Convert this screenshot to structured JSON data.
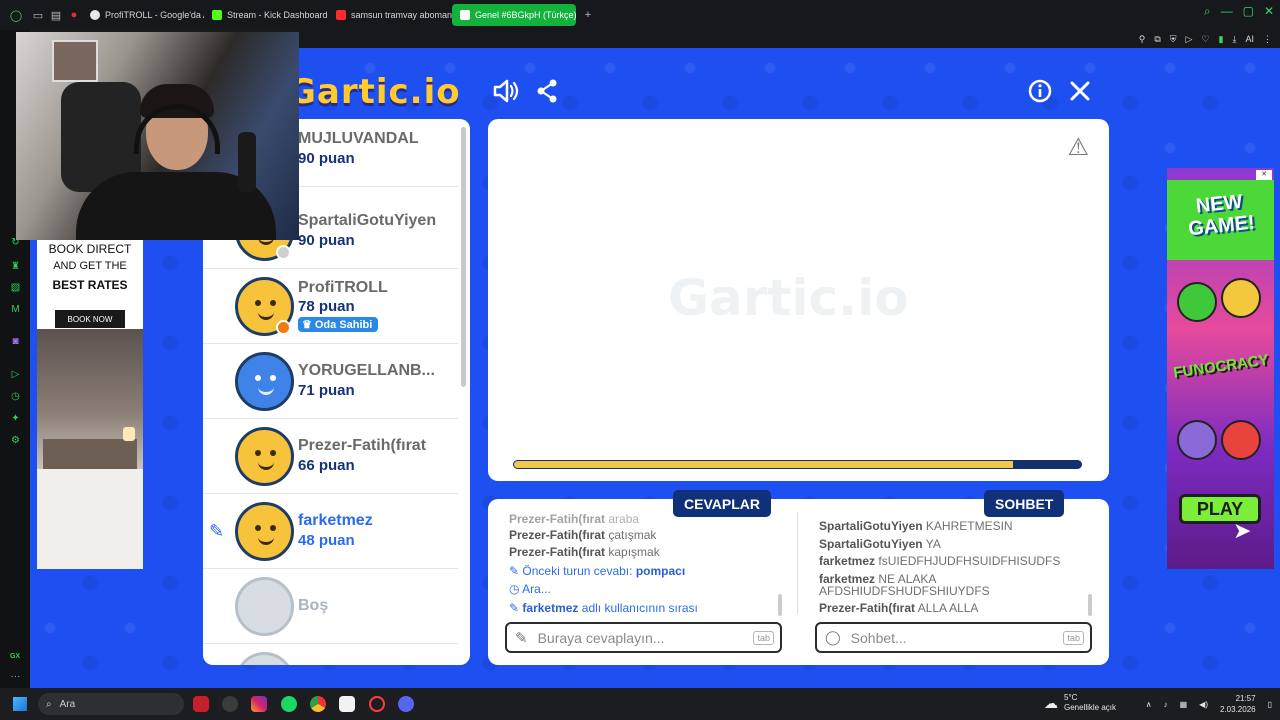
{
  "browser": {
    "tabs": [
      {
        "label": "ProfiTROLL - Google'da Ar",
        "color": "#e8e8e8"
      },
      {
        "label": "Stream - Kick Dashboard",
        "color": "#53fc18"
      },
      {
        "label": "samsun tramvay aboman",
        "color": "#ff2b2b"
      },
      {
        "label": "Genel #6BGkpH (Türkçe)",
        "color": "#ffffff"
      }
    ],
    "new_tab": "+",
    "toolbar_ai": "AI"
  },
  "gx_sidebar": {
    "gx_label": "GX",
    "more": "···"
  },
  "game": {
    "logo": "Gartic.io",
    "watermark": "Gartic.io",
    "players": [
      {
        "name": "MUJLUVANDAL",
        "score": "90 puan"
      },
      {
        "name": "SpartaliGotuYiyen",
        "score": "90 puan"
      },
      {
        "name": "ProfiTROLL",
        "score": "78 puan",
        "badge": "Oda Sahibi"
      },
      {
        "name": "YORUGELLANB...",
        "score": "71 puan"
      },
      {
        "name": "Prezer-Fatih(fırat",
        "score": "66 puan"
      },
      {
        "name": "farketmez",
        "score": "48 puan"
      },
      {
        "name": "Boş"
      }
    ],
    "timer_progress": 0.88,
    "answers": {
      "tab_label": "CEVAPLAR",
      "messages": [
        {
          "user": "Prezer-Fatih(fırat",
          "text": "araba"
        },
        {
          "user": "Prezer-Fatih(fırat",
          "text": "çatışmak"
        },
        {
          "user": "Prezer-Fatih(fırat",
          "text": "kapışmak"
        }
      ],
      "system": {
        "prev_answer_label": "Önceki turun cevabı:",
        "prev_answer": "pompacı",
        "searching": "Ara...",
        "turn_user": "farketmez",
        "turn_text": "adlı kullanıcının sırası"
      },
      "placeholder": "Buraya cevaplayın...",
      "key_hint": "tab"
    },
    "chat": {
      "tab_label": "SOHBET",
      "messages": [
        {
          "user": "SpartaliGotuYiyen",
          "text": "KAHRETMESIN"
        },
        {
          "user": "SpartaliGotuYiyen",
          "text": "YA"
        },
        {
          "user": "farketmez",
          "text": "fsUIEDFHJUDFHSUIDFHISUDFS"
        },
        {
          "user": "farketmez",
          "text": "NE ALAKA"
        },
        {
          "user": "",
          "text": "AFDSHIUDFSHUDFSHIUYDFS"
        },
        {
          "user": "Prezer-Fatih(fırat",
          "text": "ALLA ALLA"
        }
      ],
      "placeholder": "Sohbet...",
      "key_hint": "tab"
    }
  },
  "hotel_ad": {
    "line1": "BOOK DIRECT",
    "line2": "AND GET THE",
    "line3": "BEST RATES",
    "button": "BOOK NOW"
  },
  "game_ad": {
    "title_line1": "NEW",
    "title_line2": "GAME!",
    "brand": "FUNOCRACY",
    "play": "PLAY"
  },
  "taskbar": {
    "search": "Ara",
    "weather_temp": "5°C",
    "weather_desc": "Genellikle açık",
    "time": "21:57",
    "date": "2.03.2026"
  }
}
